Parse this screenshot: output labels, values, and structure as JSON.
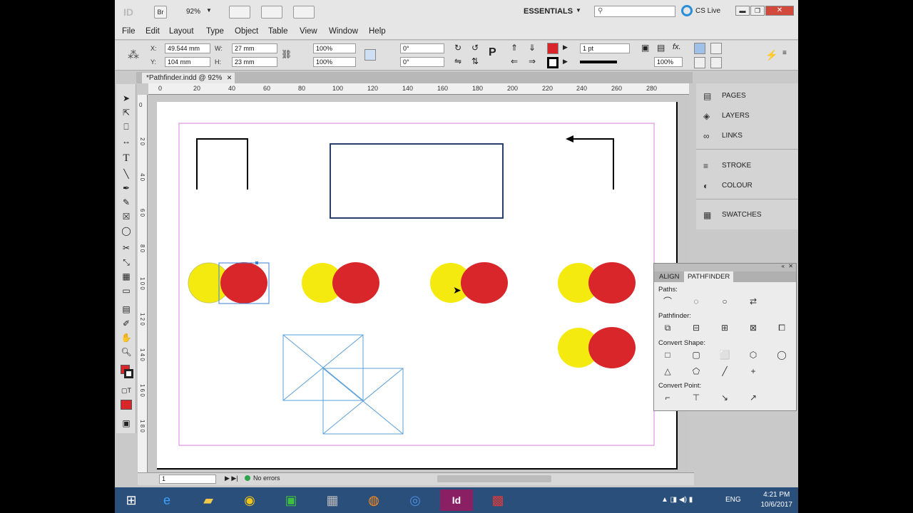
{
  "window": {
    "zoom": "92%",
    "workspace": "ESSENTIALS",
    "cslive": "CS Live",
    "search_placeholder": ""
  },
  "menu": [
    "File",
    "Edit",
    "Layout",
    "Type",
    "Object",
    "Table",
    "View",
    "Window",
    "Help"
  ],
  "control": {
    "x_label": "X:",
    "x_value": "49.544 mm",
    "y_label": "Y:",
    "y_value": "104 mm",
    "w_label": "W:",
    "w_value": "27 mm",
    "h_label": "H:",
    "h_value": "23 mm",
    "scale_x": "100%",
    "scale_y": "100%",
    "rotate": "0°",
    "shear": "0°",
    "stroke_weight": "1 pt",
    "opacity": "100%"
  },
  "document": {
    "tab_title": "*Pathfinder.indd @ 92%"
  },
  "ruler": {
    "h_ticks": [
      "0",
      "20",
      "40",
      "60",
      "80",
      "100",
      "120",
      "140",
      "160",
      "180",
      "200",
      "220",
      "240",
      "260",
      "280"
    ],
    "v_ticks": [
      "0",
      "2 0",
      "4 0",
      "6 0",
      "8 0",
      "1 0 0",
      "1 2 0",
      "1 4 0",
      "1 6 0",
      "1 8 0"
    ]
  },
  "status": {
    "page": "1",
    "errors": "No errors"
  },
  "panels": {
    "items": [
      {
        "label": "PAGES",
        "icon": "pages-icon"
      },
      {
        "label": "LAYERS",
        "icon": "layers-icon"
      },
      {
        "label": "LINKS",
        "icon": "links-icon"
      },
      {
        "label": "STROKE",
        "icon": "stroke-icon"
      },
      {
        "label": "COLOUR",
        "icon": "colour-icon"
      },
      {
        "label": "SWATCHES",
        "icon": "swatches-icon"
      }
    ]
  },
  "pathfinder": {
    "tabs": [
      "ALIGN",
      "PATHFINDER"
    ],
    "active_tab": "PATHFINDER",
    "sections": {
      "paths": "Paths:",
      "pathfinder": "Pathfinder:",
      "convert_shape": "Convert Shape:",
      "convert_point": "Convert Point:"
    }
  },
  "taskbar": {
    "time": "4:21 PM",
    "date": "10/6/2017",
    "lang": "ENG"
  },
  "colors": {
    "yellow": "#f4ea10",
    "red": "#d8262b",
    "guide": "#d87fd8",
    "selection": "#3b82d6",
    "frame": "#2a3f6e"
  }
}
